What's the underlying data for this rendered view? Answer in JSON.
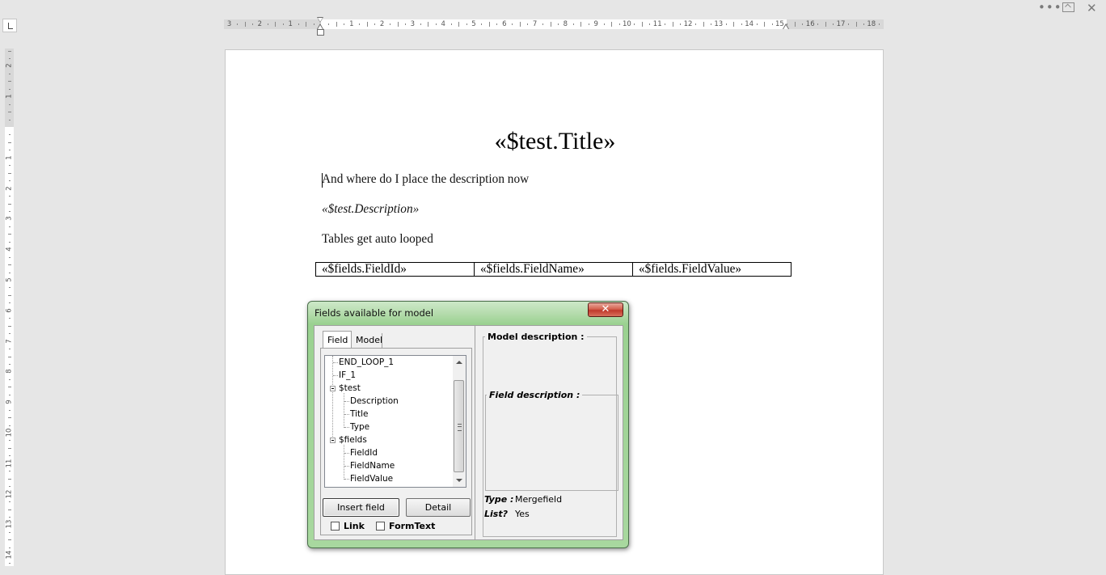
{
  "window": {
    "more_glyph": "•••",
    "close_glyph": "✕"
  },
  "ruler": {
    "horizontal_labels_left": [
      "3",
      "2",
      "1"
    ],
    "horizontal_labels_right": [
      "1",
      "2",
      "3",
      "4",
      "5",
      "6",
      "7",
      "8",
      "9",
      "10",
      "11",
      "12",
      "13",
      "14",
      "15",
      "16",
      "17",
      "18"
    ],
    "vertical_labels_top": [
      "2",
      "1"
    ],
    "vertical_labels_body": [
      "1",
      "2",
      "3",
      "4",
      "5",
      "6",
      "7",
      "8",
      "9",
      "10",
      "11",
      "12",
      "13",
      "14"
    ]
  },
  "document": {
    "title": "«$test.Title»",
    "paragraph_1": "And where do I place the description now",
    "paragraph_2": "«$test.Description»",
    "paragraph_3": "Tables get auto looped",
    "table_row": [
      "«$fields.FieldId»",
      "«$fields.FieldName»",
      "«$fields.FieldValue»"
    ]
  },
  "dialog": {
    "title": "Fields available for model",
    "close_glyph": "✕",
    "tabs": [
      "Field",
      "Model"
    ],
    "tree": [
      {
        "label": "END_LOOP_1"
      },
      {
        "label": "IF_1"
      },
      {
        "label": "$test"
      },
      {
        "label": "Description"
      },
      {
        "label": "Title"
      },
      {
        "label": "Type"
      },
      {
        "label": "$fields"
      },
      {
        "label": "FieldId"
      },
      {
        "label": "FieldName"
      },
      {
        "label": "FieldValue"
      }
    ],
    "insert_button": "Insert field",
    "detail_button": "Detail",
    "link_label": "Link",
    "formtext_label": "FormText",
    "model_description_legend": "Model description :",
    "field_description_legend": "Field description :",
    "type_label": "Type :",
    "type_value": "Mergefield",
    "list_label": "List?",
    "list_value": "Yes"
  },
  "colors": {
    "dialog_frame": "#9ad190",
    "close_button": "#c0392b",
    "workspace": "#e6e6e6"
  }
}
